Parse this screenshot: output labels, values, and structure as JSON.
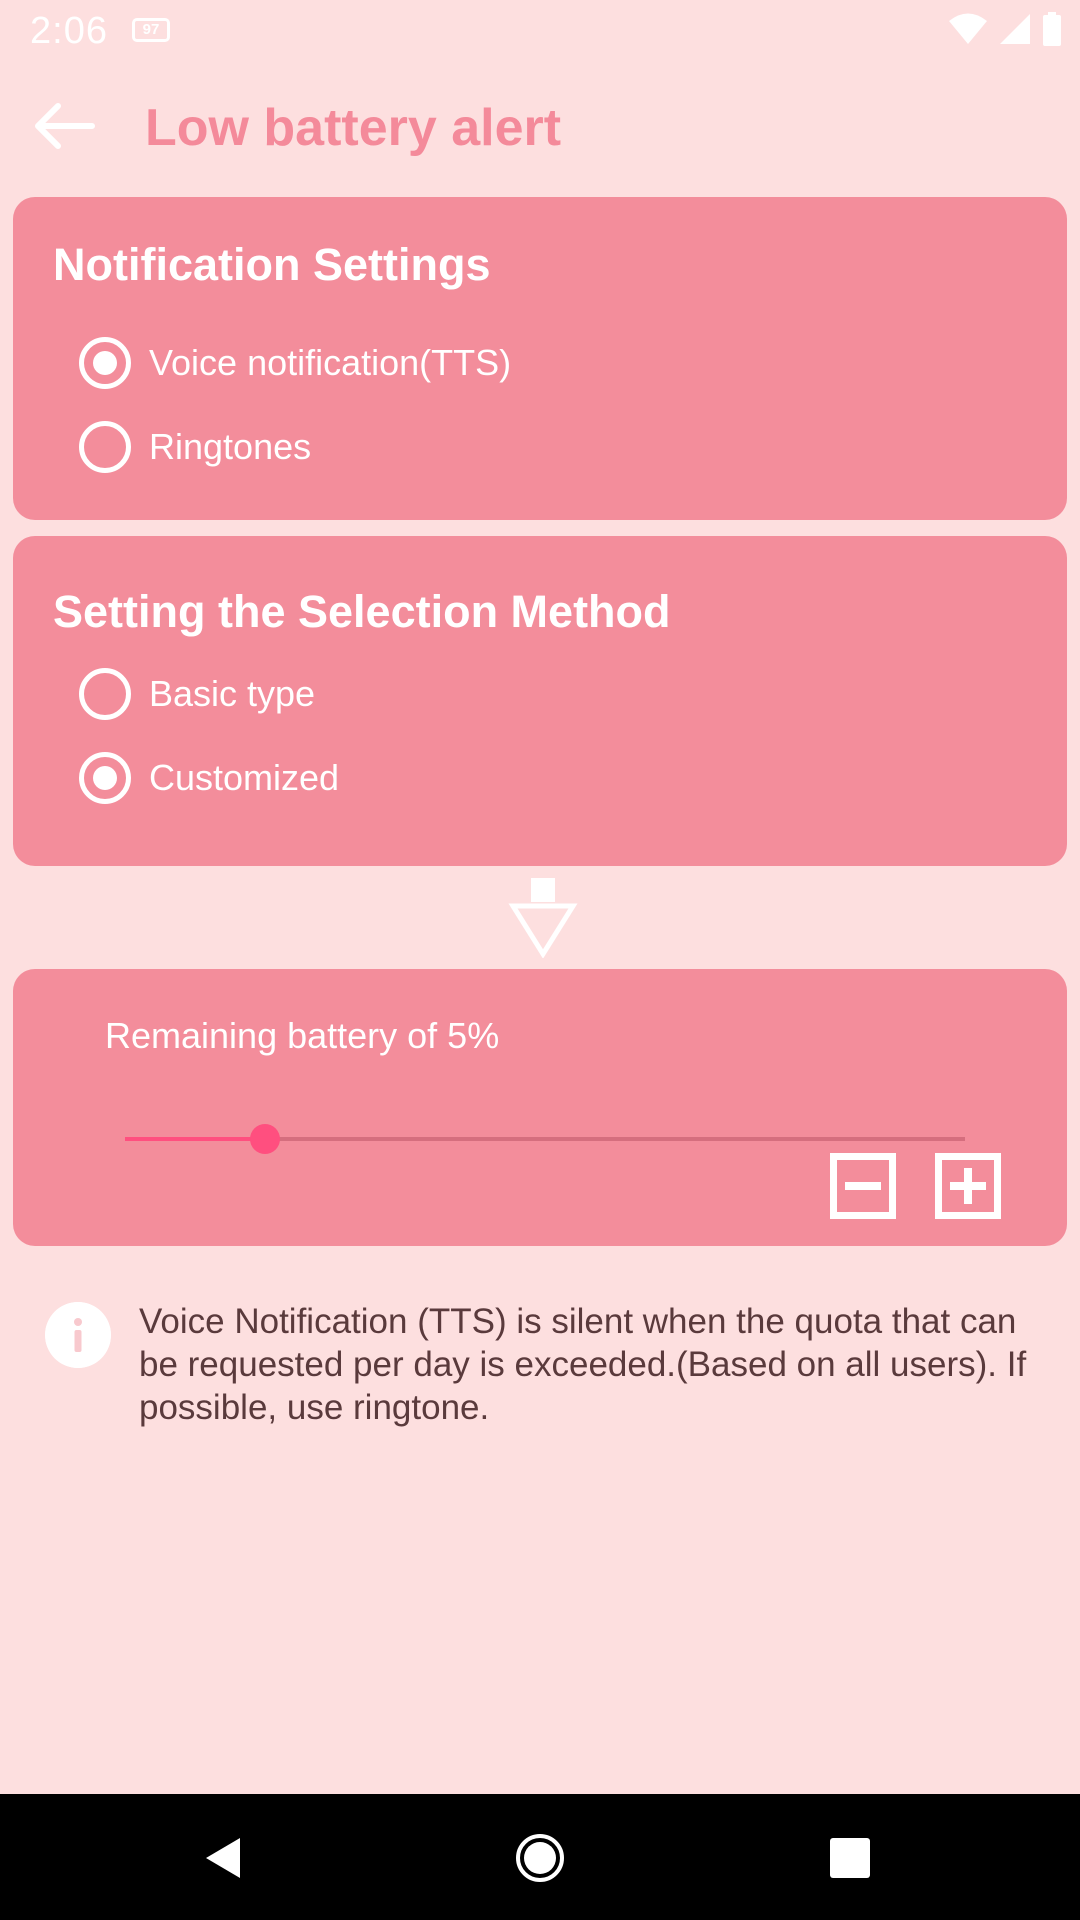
{
  "status_bar": {
    "time": "2:06",
    "battery_badge": "97"
  },
  "app_bar": {
    "title": "Low battery alert"
  },
  "notification_settings": {
    "title": "Notification Settings",
    "options": [
      {
        "label": "Voice notification(TTS)",
        "checked": true
      },
      {
        "label": "Ringtones",
        "checked": false
      }
    ]
  },
  "selection_method": {
    "title": "Setting the Selection Method",
    "options": [
      {
        "label": "Basic type",
        "checked": false
      },
      {
        "label": "Customized",
        "checked": true
      }
    ]
  },
  "battery": {
    "label": "Remaining battery of 5%",
    "slider_fraction": 0.167
  },
  "info": {
    "text": "Voice Notification (TTS) is silent when the quota that can be requested per day is exceeded.(Based on all users). If possible, use ringtone."
  },
  "colors": {
    "background": "#FDDFDF",
    "card": "#F38D9B",
    "title": "#F48A9A",
    "accent": "#FF4F7F"
  }
}
